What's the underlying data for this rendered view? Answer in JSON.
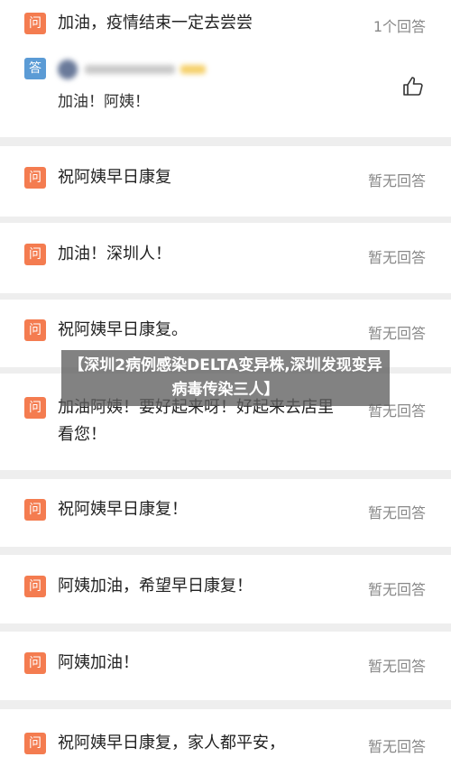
{
  "question_icon": "问",
  "answer_icon": "答",
  "questions": [
    {
      "text": "加油，疫情结束一定去尝尝",
      "count": "1个回答"
    },
    {
      "text": "祝阿姨早日康复",
      "count": "暂无回答"
    },
    {
      "text": "加油！深圳人！",
      "count": "暂无回答"
    },
    {
      "text": "祝阿姨早日康复。",
      "count": "暂无回答"
    },
    {
      "text": "加油阿姨！要好起来呀！好起来去店里看您！",
      "count": "暂无回答"
    },
    {
      "text": "祝阿姨早日康复！",
      "count": "暂无回答"
    },
    {
      "text": "阿姨加油，希望早日康复！",
      "count": "暂无回答"
    },
    {
      "text": "阿姨加油！",
      "count": "暂无回答"
    },
    {
      "text": "祝阿姨早日康复，家人都平安，",
      "count": "暂无回答"
    }
  ],
  "first_answer": {
    "text": "加油！阿姨！"
  },
  "banner": {
    "text": "【深圳2病例感染DELTA变异株,深圳发现变异病毒传染三人】"
  },
  "colors": {
    "question_icon": "#f47c50",
    "answer_icon": "#5b9bd5",
    "divider": "#eeeeee"
  },
  "icons": {
    "like": "thumbs-up-icon"
  }
}
